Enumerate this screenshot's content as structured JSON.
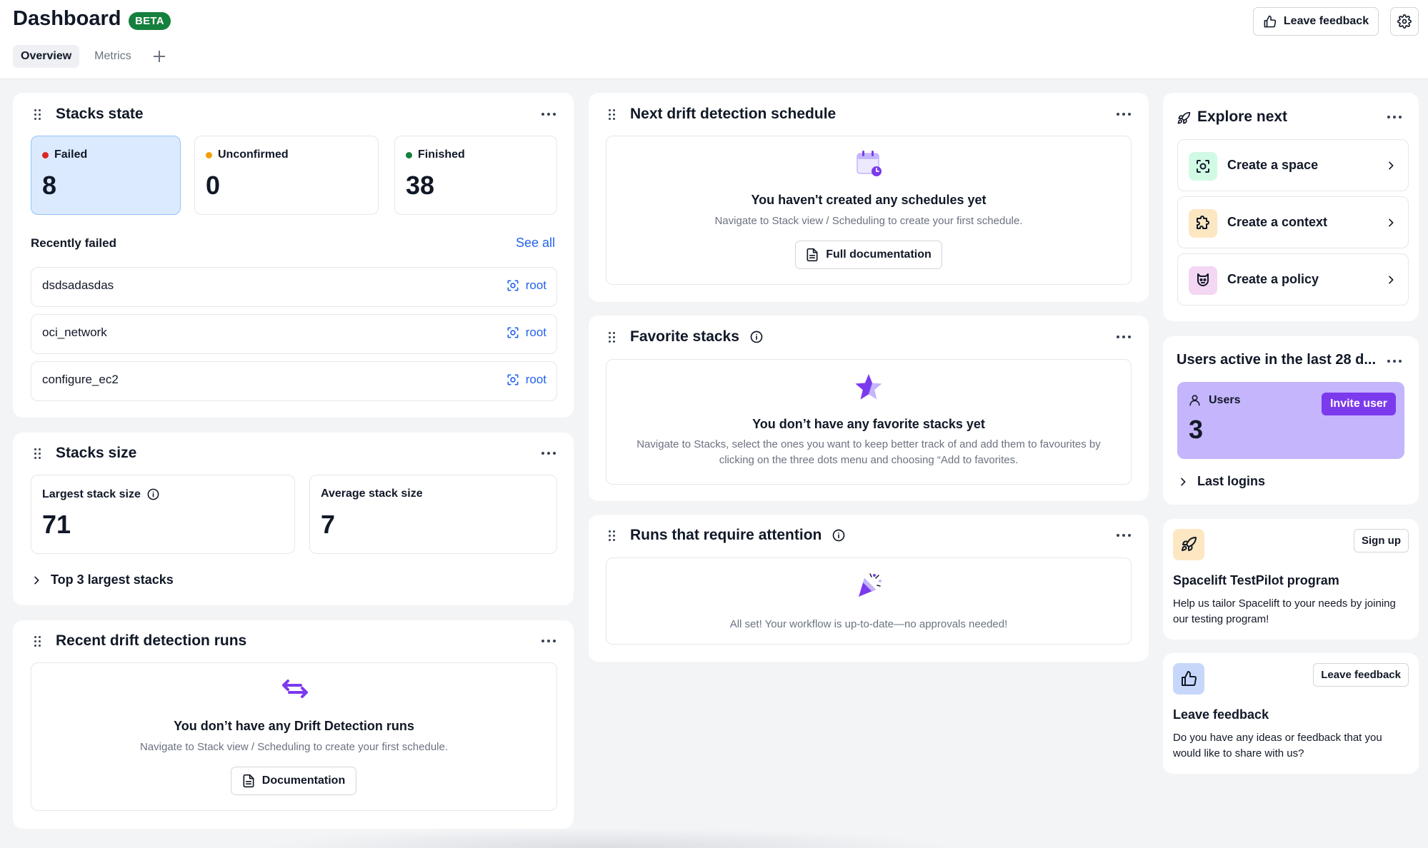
{
  "header": {
    "title": "Dashboard",
    "badge": "BETA",
    "tabs": [
      {
        "label": "Overview",
        "active": true
      },
      {
        "label": "Metrics",
        "active": false
      }
    ],
    "feedback_button": "Leave feedback"
  },
  "stacks_state": {
    "title": "Stacks state",
    "stats": [
      {
        "label": "Failed",
        "value": "8",
        "dot_color": "#dc2626"
      },
      {
        "label": "Unconfirmed",
        "value": "0",
        "dot_color": "#f59e0b"
      },
      {
        "label": "Finished",
        "value": "38",
        "dot_color": "#15803d"
      }
    ],
    "recently_failed_label": "Recently failed",
    "see_all": "See all",
    "failed_stacks": [
      {
        "name": "dsdsadasdas",
        "space": "root"
      },
      {
        "name": "oci_network",
        "space": "root"
      },
      {
        "name": "configure_ec2",
        "space": "root"
      }
    ]
  },
  "stacks_size": {
    "title": "Stacks size",
    "largest_label": "Largest stack size",
    "largest_value": "71",
    "average_label": "Average stack size",
    "average_value": "7",
    "top_label": "Top 3 largest stacks"
  },
  "drift_runs": {
    "title": "Recent drift detection runs",
    "empty_title": "You don’t have any Drift Detection runs",
    "empty_desc": "Navigate to Stack view / Scheduling to create your first schedule.",
    "button": "Documentation"
  },
  "drift_schedule": {
    "title": "Next drift detection schedule",
    "empty_title": "You haven't created any schedules yet",
    "empty_desc": "Navigate to Stack view / Scheduling to create your first schedule.",
    "button": "Full documentation"
  },
  "favorites": {
    "title": "Favorite stacks",
    "empty_title": "You don’t have any favorite stacks yet",
    "empty_desc": "Navigate to Stacks, select the ones you want to keep better track of and add them to favourites by clicking on the three dots menu and choosing “Add to favorites."
  },
  "attention": {
    "title": "Runs that require attention",
    "empty_desc": "All set! Your workflow is up-to-date—no approvals needed!"
  },
  "explore": {
    "title": "Explore next",
    "items": [
      {
        "label": "Create a space",
        "tile_color": "#d1fae5"
      },
      {
        "label": "Create a context",
        "tile_color": "#fde7c2"
      },
      {
        "label": "Create a policy",
        "tile_color": "#f3d7f3"
      }
    ]
  },
  "users_active": {
    "title": "Users active in the last 28 d...",
    "users_label": "Users",
    "users_value": "3",
    "invite_button": "Invite user",
    "last_logins": "Last logins"
  },
  "testpilot": {
    "title": "Spacelift TestPilot program",
    "desc": "Help us tailor Spacelift to your needs by joining our testing program!",
    "button": "Sign up"
  },
  "feedback_card": {
    "title": "Leave feedback",
    "desc": "Do you have any ideas or feedback that you would like to share with us?",
    "button": "Leave feedback"
  },
  "colors": {
    "accent": "#2563eb",
    "failed_bg": "#dbeafe",
    "purple": "#7c3aed",
    "users_bg": "#c4b5fd"
  }
}
